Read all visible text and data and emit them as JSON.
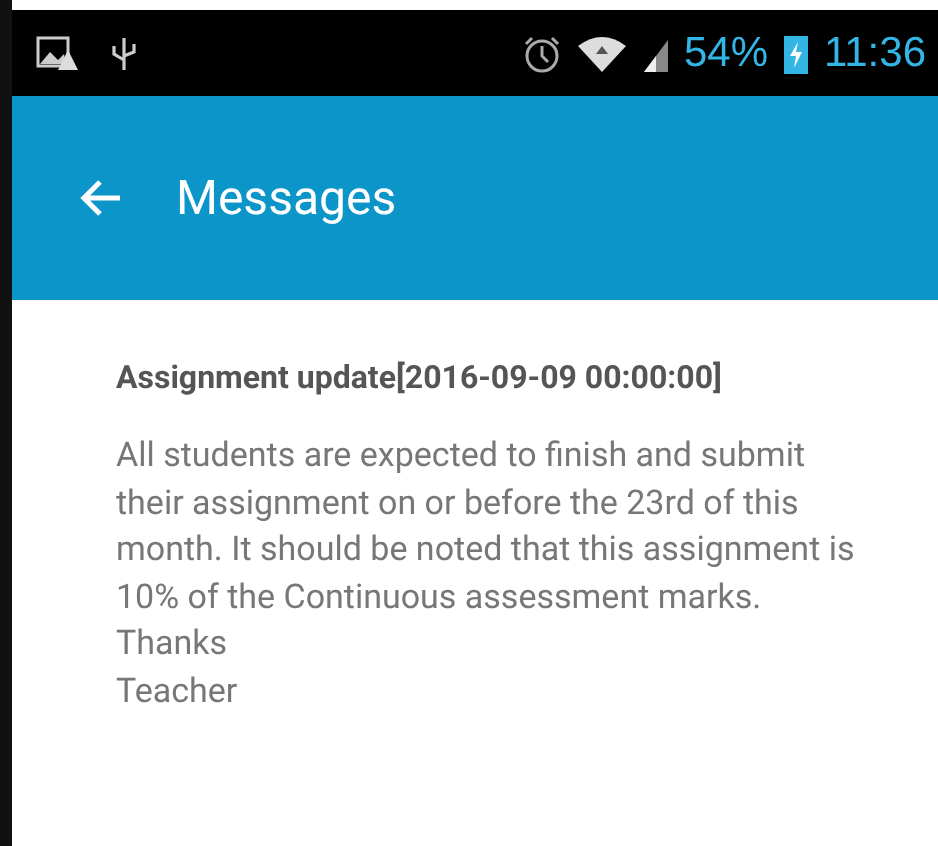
{
  "status_bar": {
    "battery": "54%",
    "time": "11:36"
  },
  "app_bar": {
    "title": "Messages"
  },
  "message": {
    "title": "Assignment update[2016-09-09 00:00:00]",
    "body": [
      "All students are expected to finish and submit their assignment on or before the 23rd of this month. It should be noted that this assignment is 10% of the Continuous assessment marks.",
      "Thanks",
      "Teacher"
    ]
  }
}
